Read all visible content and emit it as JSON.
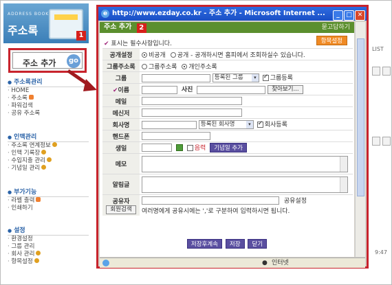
{
  "sidebar": {
    "logo_small": "ADDRESS BOOK",
    "logo_title": "주소록",
    "badge1": "1",
    "add_button": "주소 추가",
    "go_label": "go",
    "sections": [
      {
        "title": "주소록관리",
        "items": [
          "HOME",
          "주소록",
          "파워검색",
          "공유 주소록"
        ]
      },
      {
        "title": "인맥관리",
        "items": [
          "주소록 연계정보",
          "인맥 기록장",
          "수입지출 관리",
          "기념일 관리"
        ]
      },
      {
        "title": "부가기능",
        "items": [
          "라벨 출력",
          "인쇄하기"
        ]
      },
      {
        "title": "설정",
        "items": [
          "환경설정",
          "그룹 관리",
          "회사 관리",
          "항목설정"
        ]
      }
    ]
  },
  "window": {
    "title": "http://www.ezday.co.kr - 주소 추가 - Microsoft Internet ...",
    "header_title": "주소 추가",
    "badge2": "2",
    "help": "묻고답하기",
    "required_note": "표시는 필수사항입니다.",
    "item_settings": "항목설정",
    "rows": {
      "visibility": {
        "label": "공개설정",
        "opt1": "비공개",
        "opt2": "공개 - 공개하시면 홈피에서 조회하실수 있습니다."
      },
      "group_type": {
        "label": "그룹주소록",
        "opt1": "그룹주소록",
        "opt2": "개인주소록"
      },
      "group": {
        "label": "그룹",
        "select": "등록된 그룹",
        "check": "그룹등록"
      },
      "name": {
        "label": "이름",
        "photo": "사진",
        "browse": "찾아보기..."
      },
      "email": {
        "label": "메일"
      },
      "messenger": {
        "label": "메신저"
      },
      "company": {
        "label": "회사명",
        "select": "등록된 회사명",
        "check": "회사등록"
      },
      "mobile": {
        "label": "핸드폰"
      },
      "birthday": {
        "label": "생일",
        "lunar": "음력",
        "add_anniv": "기념일 추가"
      },
      "memo": {
        "label": "메모"
      },
      "notice": {
        "label": "알림글"
      },
      "sharer": {
        "label": "공유자",
        "search": "회원검색",
        "share_setting": "공유설정",
        "hint": "여러명에게 공유시에는 ','로 구분하여 입력하시면 됩니다."
      }
    },
    "actions": [
      "저장후계속",
      "저장",
      "닫기"
    ],
    "status": "인터넷"
  },
  "background": {
    "list_label": "LIST",
    "time": "9:47"
  }
}
